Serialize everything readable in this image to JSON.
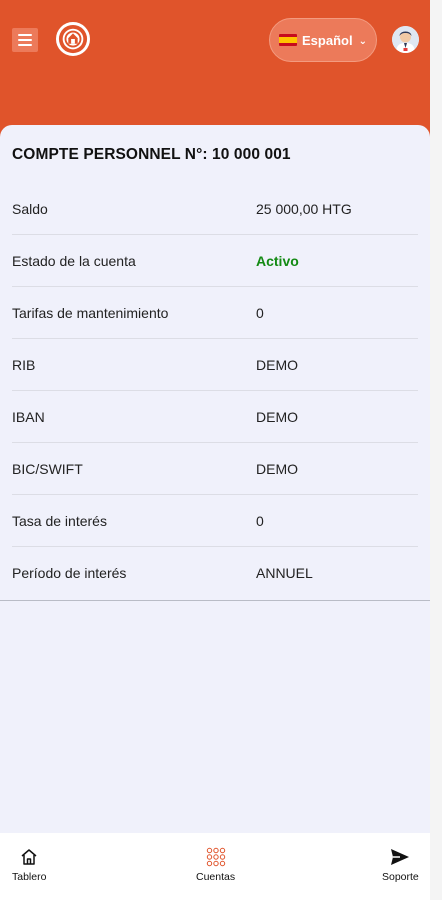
{
  "header": {
    "language": {
      "label": "Español",
      "flag": "spain-flag"
    },
    "colors": {
      "brand": "#e0542b",
      "accent_light": "#ec7a5a"
    }
  },
  "account": {
    "title": "COMPTE PERSONNEL N°: 10 000 001",
    "rows": [
      {
        "label": "Saldo",
        "value": "25 000,00 HTG"
      },
      {
        "label": "Estado de la cuenta",
        "value": "Activo",
        "status_color": "#138a13"
      },
      {
        "label": "Tarifas de mantenimiento",
        "value": "0"
      },
      {
        "label": "RIB",
        "value": "DEMO"
      },
      {
        "label": "IBAN",
        "value": "DEMO"
      },
      {
        "label": "BIC/SWIFT",
        "value": "DEMO"
      },
      {
        "label": "Tasa de interés",
        "value": "0"
      },
      {
        "label": "Período de interés",
        "value": "ANNUEL"
      }
    ]
  },
  "bottom_nav": {
    "items": [
      {
        "label": "Tablero",
        "icon": "home-icon"
      },
      {
        "label": "Cuentas",
        "icon": "grid-icon"
      },
      {
        "label": "Soporte",
        "icon": "send-icon"
      }
    ]
  }
}
